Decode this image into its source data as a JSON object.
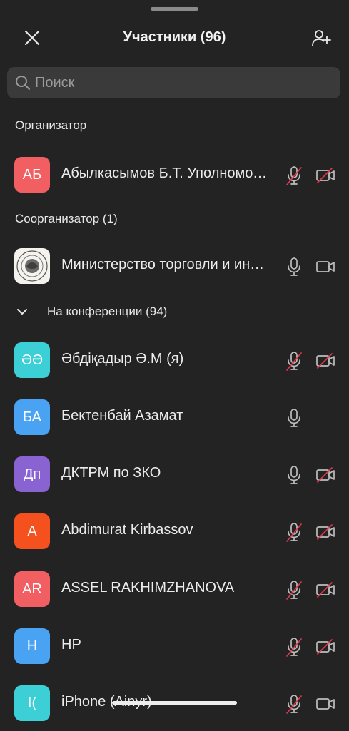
{
  "header": {
    "title": "Участники (96)"
  },
  "search": {
    "placeholder": "Поиск"
  },
  "sections": {
    "host": "Организатор",
    "cohost": "Соорганизатор (1)",
    "in_meeting": "На конференции (94)"
  },
  "participants": [
    {
      "initials": "АБ",
      "name": "Абылкасымов Б.Т. Уполномоченный",
      "avatar_color": "#f25f63",
      "mic": "muted",
      "camera": "off"
    },
    {
      "initials": "",
      "name": "Министерство торговли и интеграции",
      "avatar_color": "#f5f3ee",
      "mic": "on",
      "camera": "on"
    },
    {
      "initials": "ӘӘ",
      "name": "Әбдіқадыр Ә.М (я)",
      "avatar_color": "#3dcfd6",
      "mic": "muted",
      "camera": "off"
    },
    {
      "initials": "БА",
      "name": "Бектенбай Азамат",
      "avatar_color": "#4aa3f2",
      "mic": "on",
      "camera": "none"
    },
    {
      "initials": "Дп",
      "name": "ДКТРМ по ЗКО",
      "avatar_color": "#8a63d2",
      "mic": "on",
      "camera": "off"
    },
    {
      "initials": "A",
      "name": "Abdimurat Kirbassov",
      "avatar_color": "#f4511e",
      "mic": "muted",
      "camera": "off"
    },
    {
      "initials": "AR",
      "name": "ASSEL RAKHIMZHANOVA",
      "avatar_color": "#f25f63",
      "mic": "muted",
      "camera": "off"
    },
    {
      "initials": "H",
      "name": "HP",
      "avatar_color": "#4aa3f2",
      "mic": "muted",
      "camera": "off"
    },
    {
      "initials": "I(",
      "name": "iPhone (Ainyr)",
      "avatar_color": "#3dcfd6",
      "mic": "muted",
      "camera": "on"
    }
  ],
  "colors": {
    "background": "#232323",
    "muted_slash": "#e0374a",
    "icon": "#bdbdbd"
  }
}
